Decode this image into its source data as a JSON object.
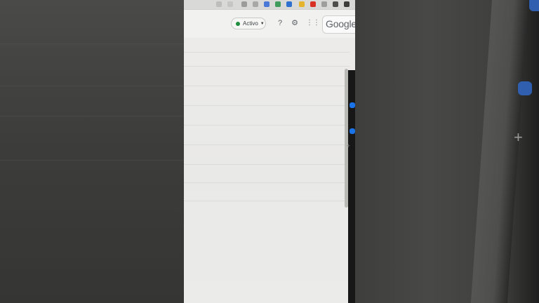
{
  "header": {
    "status_label": "Activo",
    "status_color": "#1e8e3e",
    "help_icon": "help-icon",
    "settings_icon": "gear-icon",
    "apps_icon": "apps-grid-icon",
    "account_text": "Google"
  },
  "browser_toolbar": {
    "icons": [
      "share-icon",
      "star-icon",
      "extension-icon",
      "extension-icon",
      "extension-icon",
      "extension-icon",
      "extension-icon",
      "extension-icon",
      "extension-icon",
      "extension-icon",
      "puzzle-icon",
      "sidebar-icon"
    ]
  },
  "side_rail": {
    "plus": "+"
  }
}
